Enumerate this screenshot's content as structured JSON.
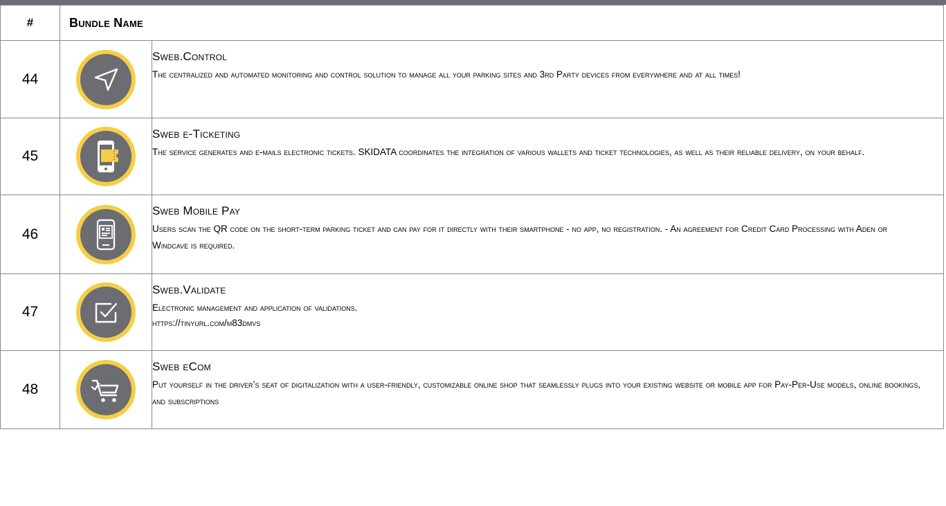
{
  "table": {
    "header": {
      "num": "#",
      "name": "Bundle Name"
    },
    "rows": [
      {
        "num": "44",
        "icon": "send-arrow-icon",
        "title": "Sweb.Control",
        "lines": [
          "The centralized and automated monitoring and control solution to manage all your parking sites and 3rd Party devices from everywhere and at all times!"
        ]
      },
      {
        "num": "45",
        "icon": "phone-ticket-icon",
        "title": "Sweb e-Ticketing",
        "lines": [
          "The service generates and e-mails electronic tickets. SKIDATA coordinates the integration of various wallets and ticket technologies, as well as their reliable delivery, on your behalf."
        ]
      },
      {
        "num": "46",
        "icon": "mobile-pay-icon",
        "title": "Sweb Mobile Pay",
        "lines": [
          "Users scan the QR code on the short-term parking ticket and can pay for it directly with their smartphone - no app, no registration. - An agreement for Credit Card Processing with Aden or Windcave is required."
        ]
      },
      {
        "num": "47",
        "icon": "checkbox-icon",
        "title": "Sweb.Validate",
        "lines": [
          "Electronic management and application of validations.",
          "https://tinyurl.com/m83dmvs"
        ]
      },
      {
        "num": "48",
        "icon": "shopping-cart-icon",
        "title": "Sweb eCom",
        "lines": [
          "Put yourself in the driver’s seat of digitalization with a user-friendly, customizable online shop that seamlessly plugs into your existing website or mobile app for Pay-Per-Use models, online bookings, and subscriptions"
        ]
      }
    ]
  },
  "colors": {
    "accent_ring": "#f5ce45",
    "icon_fill": "#6b6d72",
    "header_bar": "#6b6e74",
    "border": "#8a8a8a"
  }
}
